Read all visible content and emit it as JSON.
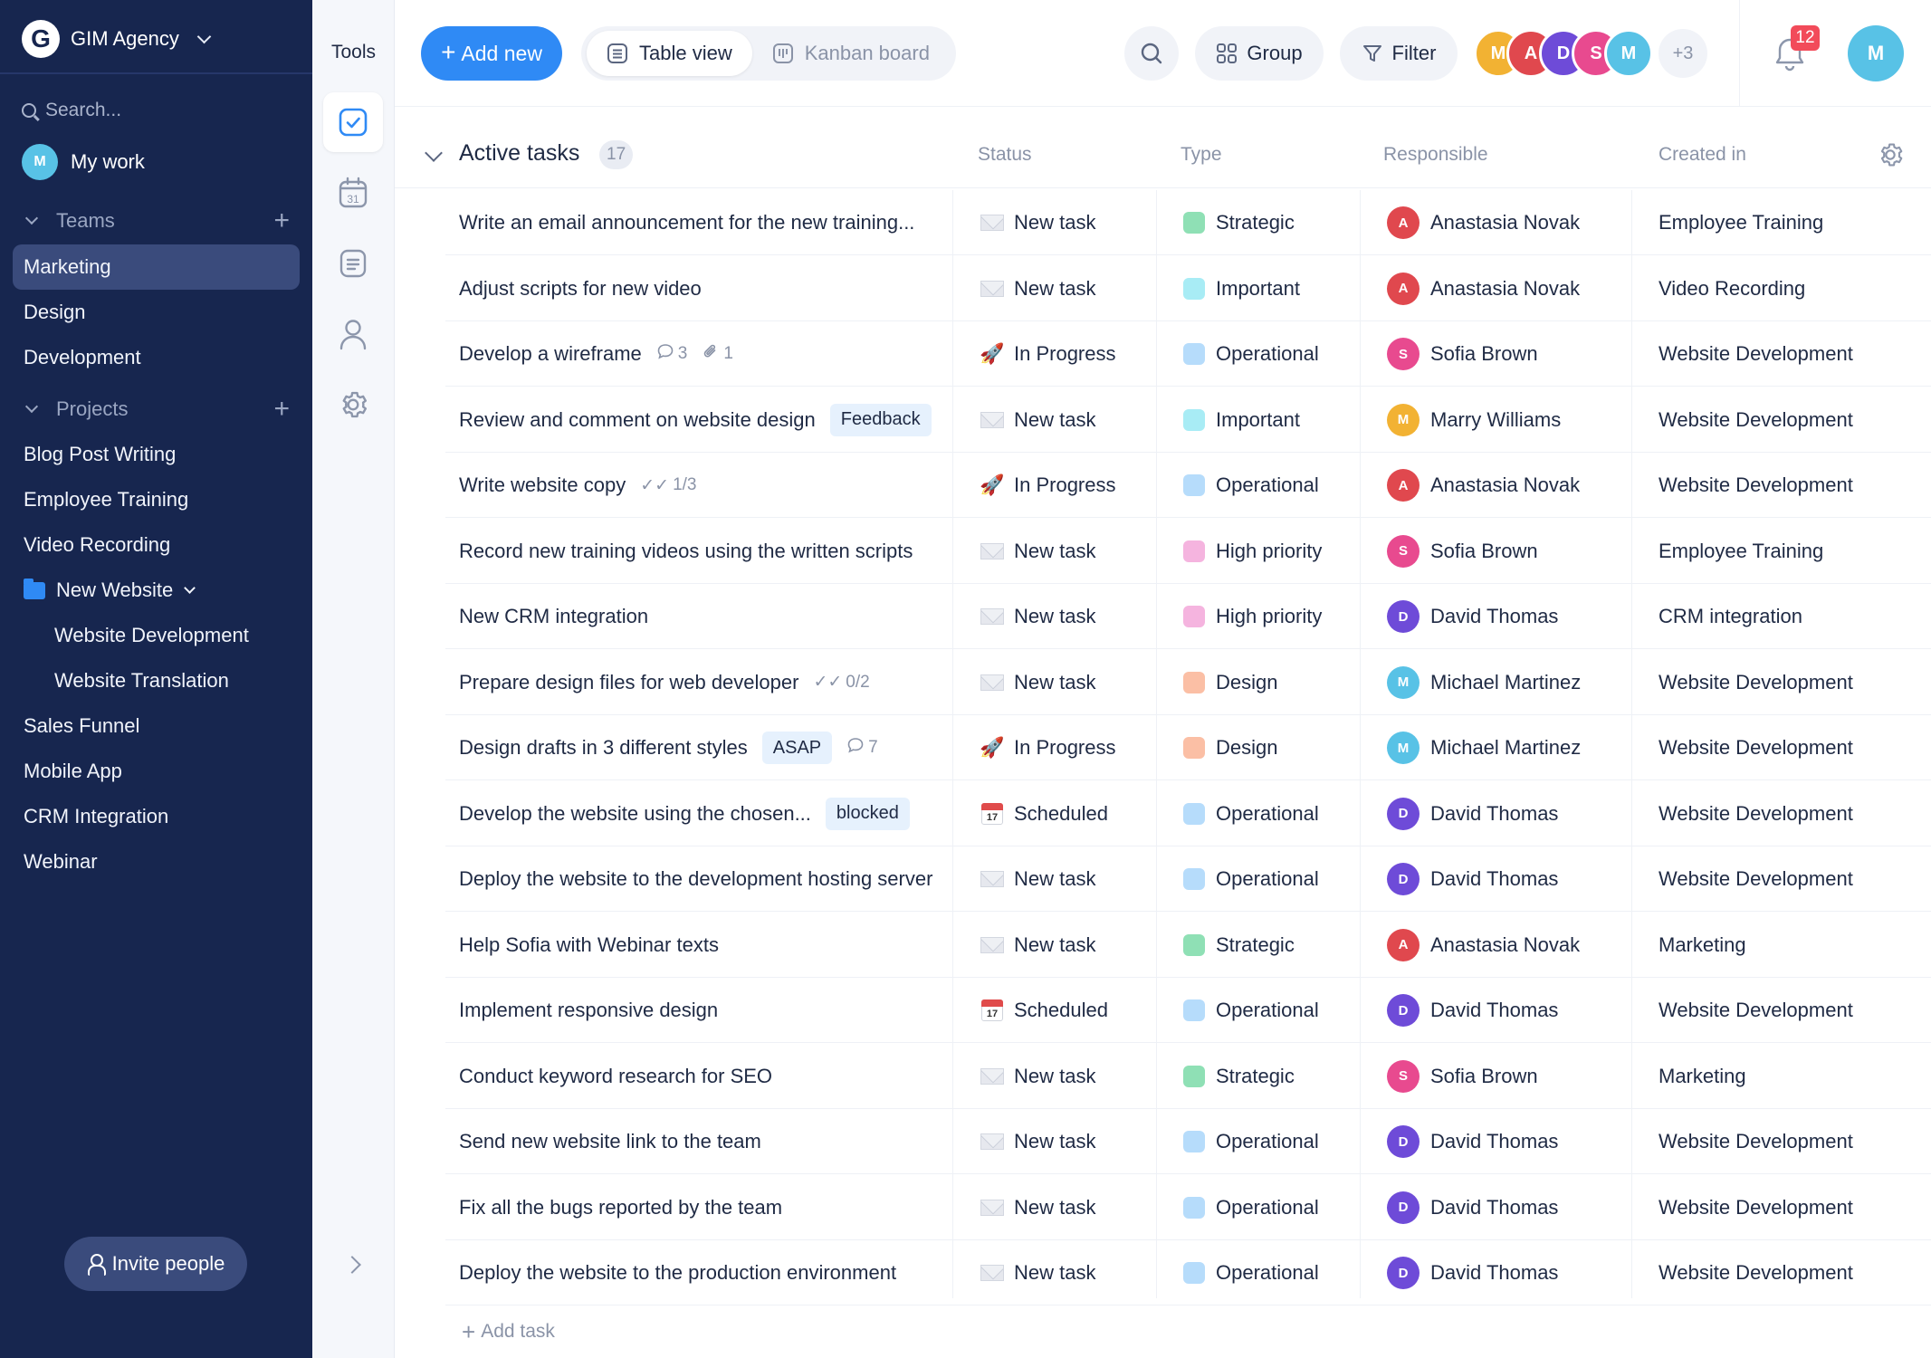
{
  "workspace": {
    "name": "GIM Agency",
    "logo_letter": "G"
  },
  "search": {
    "placeholder": "Search..."
  },
  "my_work": {
    "label": "My work"
  },
  "teams": {
    "title": "Teams",
    "items": [
      {
        "label": "Marketing",
        "active": true
      },
      {
        "label": "Design"
      },
      {
        "label": "Development"
      }
    ]
  },
  "projects": {
    "title": "Projects",
    "items": [
      {
        "label": "Blog Post Writing"
      },
      {
        "label": "Employee Training"
      },
      {
        "label": "Video Recording"
      },
      {
        "label": "New Website",
        "folder": true
      },
      {
        "label": "Website Development",
        "sub": true
      },
      {
        "label": "Website Translation",
        "sub": true
      },
      {
        "label": "Sales Funnel"
      },
      {
        "label": "Mobile App"
      },
      {
        "label": "CRM Integration"
      },
      {
        "label": "Webinar"
      }
    ]
  },
  "invite": {
    "label": "Invite people"
  },
  "tools": {
    "title": "Tools",
    "items": [
      "tasks-icon",
      "calendar-icon",
      "notes-icon",
      "people-icon",
      "settings-icon"
    ],
    "calendar_day": "31"
  },
  "toolbar": {
    "add_new": "Add new",
    "table_view": "Table view",
    "kanban_board": "Kanban board",
    "group": "Group",
    "filter": "Filter",
    "more_members": "+3",
    "notifications": "12"
  },
  "section": {
    "title": "Active tasks",
    "count": "17",
    "columns": {
      "status": "Status",
      "type": "Type",
      "responsible": "Responsible",
      "created_in": "Created in"
    }
  },
  "colors": {
    "sidebar": "#17264f",
    "accent": "#2f8af5",
    "Strategic": "#8fe0b5",
    "Important": "#a8ecf5",
    "Operational": "#b6dcfb",
    "High priority": "#f5b4df",
    "Design": "#fbbfa5"
  },
  "people": {
    "Anastasia Novak": "#e0484e",
    "Sofia Brown": "#e84a8f",
    "Marry Williams": "#f2b233",
    "David Thomas": "#6e4bd8",
    "Michael Martinez": "#58c2e6"
  },
  "tasks": [
    {
      "name": "Write an email announcement for the new training...",
      "status": "New task",
      "status_icon": "envelope-icon",
      "type": "Strategic",
      "responsible": "Anastasia Novak",
      "project": "Employee Training"
    },
    {
      "name": "Adjust scripts for new video",
      "status": "New task",
      "status_icon": "envelope-icon",
      "type": "Important",
      "responsible": "Anastasia Novak",
      "project": "Video Recording"
    },
    {
      "name": "Develop a wireframe",
      "comments": "3",
      "attachments": "1",
      "status": "In Progress",
      "status_icon": "rocket-icon",
      "type": "Operational",
      "responsible": "Sofia Brown",
      "project": "Website Development"
    },
    {
      "name": "Review and comment on website design",
      "tag": "Feedback",
      "status": "New task",
      "status_icon": "envelope-icon",
      "type": "Important",
      "responsible": "Marry Williams",
      "project": "Website Development"
    },
    {
      "name": "Write website copy",
      "checklist": "1/3",
      "status": "In Progress",
      "status_icon": "rocket-icon",
      "type": "Operational",
      "responsible": "Anastasia Novak",
      "project": "Website Development"
    },
    {
      "name": "Record new training videos using the written scripts",
      "status": "New task",
      "status_icon": "envelope-icon",
      "type": "High priority",
      "responsible": "Sofia Brown",
      "project": "Employee Training"
    },
    {
      "name": "New CRM integration",
      "status": "New task",
      "status_icon": "envelope-icon",
      "type": "High priority",
      "responsible": "David Thomas",
      "project": "CRM integration"
    },
    {
      "name": "Prepare design files for web developer",
      "checklist": "0/2",
      "status": "New task",
      "status_icon": "envelope-icon",
      "type": "Design",
      "responsible": "Michael Martinez",
      "project": "Website Development"
    },
    {
      "name": "Design drafts in 3 different styles",
      "tag": "ASAP",
      "comments": "7",
      "status": "In Progress",
      "status_icon": "rocket-icon",
      "type": "Design",
      "responsible": "Michael Martinez",
      "project": "Website Development"
    },
    {
      "name": "Develop the website using the chosen...",
      "tag": "blocked",
      "status": "Scheduled",
      "status_icon": "calendar-icon",
      "type": "Operational",
      "responsible": "David Thomas",
      "project": "Website Development"
    },
    {
      "name": "Deploy the website to the development hosting server",
      "status": "New task",
      "status_icon": "envelope-icon",
      "type": "Operational",
      "responsible": "David Thomas",
      "project": "Website Development"
    },
    {
      "name": "Help Sofia with Webinar texts",
      "status": "New task",
      "status_icon": "envelope-icon",
      "type": "Strategic",
      "responsible": "Anastasia Novak",
      "project": "Marketing"
    },
    {
      "name": "Implement responsive design",
      "status": "Scheduled",
      "status_icon": "calendar-icon",
      "type": "Operational",
      "responsible": "David Thomas",
      "project": "Website Development"
    },
    {
      "name": "Conduct keyword research for SEO",
      "status": "New task",
      "status_icon": "envelope-icon",
      "type": "Strategic",
      "responsible": "Sofia Brown",
      "project": "Marketing"
    },
    {
      "name": "Send new website link to the team",
      "status": "New task",
      "status_icon": "envelope-icon",
      "type": "Operational",
      "responsible": "David Thomas",
      "project": "Website Development"
    },
    {
      "name": "Fix all the bugs reported by the team",
      "status": "New task",
      "status_icon": "envelope-icon",
      "type": "Operational",
      "responsible": "David Thomas",
      "project": "Website Development"
    },
    {
      "name": "Deploy the website to the production environment",
      "status": "New task",
      "status_icon": "envelope-icon",
      "type": "Operational",
      "responsible": "David Thomas",
      "project": "Website Development"
    }
  ],
  "add_task": {
    "label": "Add task"
  },
  "calendar_icon_day": "17"
}
